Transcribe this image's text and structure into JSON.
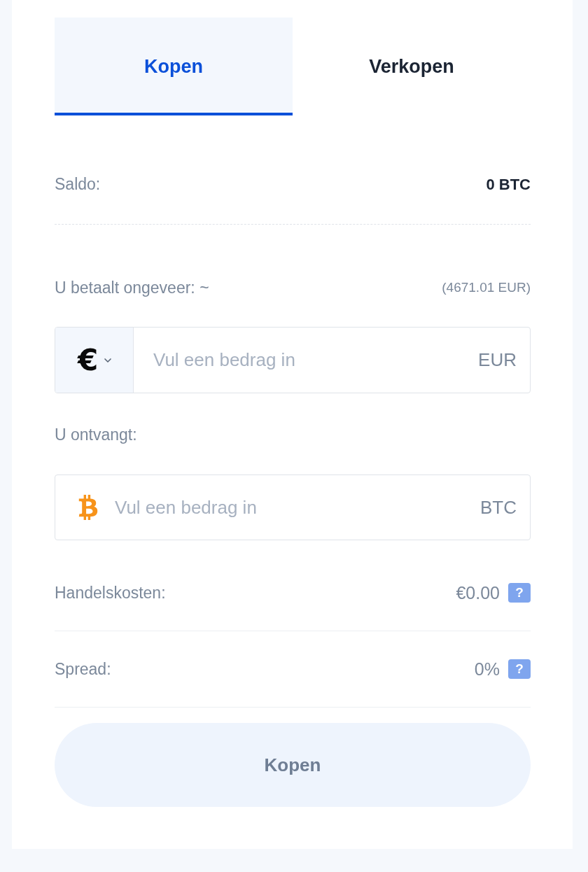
{
  "tabs": [
    {
      "label": "Kopen",
      "selected": true
    },
    {
      "label": "Verkopen",
      "selected": false
    }
  ],
  "balance": {
    "label": "Saldo:",
    "value": "0 BTC"
  },
  "pay": {
    "label": "U betaalt ongeveer: ~",
    "estimate": "(4671.01 EUR)",
    "currency_symbol": "€",
    "placeholder": "Vul een bedrag in",
    "unit": "EUR"
  },
  "receive": {
    "label": "U ontvangt:",
    "placeholder": "Vul een bedrag in",
    "unit": "BTC"
  },
  "fees": [
    {
      "label": "Handelskosten:",
      "value": "€0.00",
      "help": "?"
    },
    {
      "label": "Spread:",
      "value": "0%",
      "help": "?"
    }
  ],
  "submit": {
    "label": "Kopen",
    "disabled": true
  }
}
